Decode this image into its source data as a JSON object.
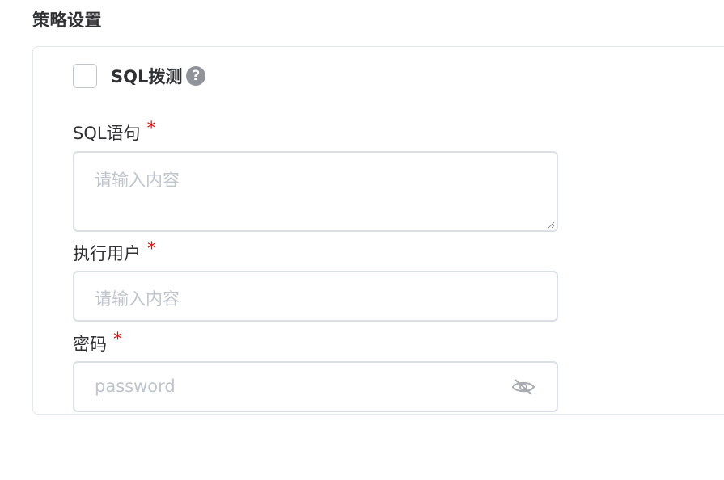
{
  "section": {
    "title": "策略设置"
  },
  "probe": {
    "label": "SQL拨测",
    "help_glyph": "?",
    "checked": false
  },
  "fields": {
    "sql": {
      "label": "SQL语句",
      "required_mark": "*",
      "placeholder": "请输入内容"
    },
    "user": {
      "label": "执行用户",
      "required_mark": "*",
      "placeholder": "请输入内容"
    },
    "password": {
      "label": "密码",
      "required_mark": "*",
      "placeholder": "password",
      "toggle_icon": "eye-off-icon"
    }
  },
  "colors": {
    "required": "#ff0000",
    "placeholder": "#c0c4cc",
    "border": "#dcdfe6",
    "help_icon_bg": "#909399"
  }
}
